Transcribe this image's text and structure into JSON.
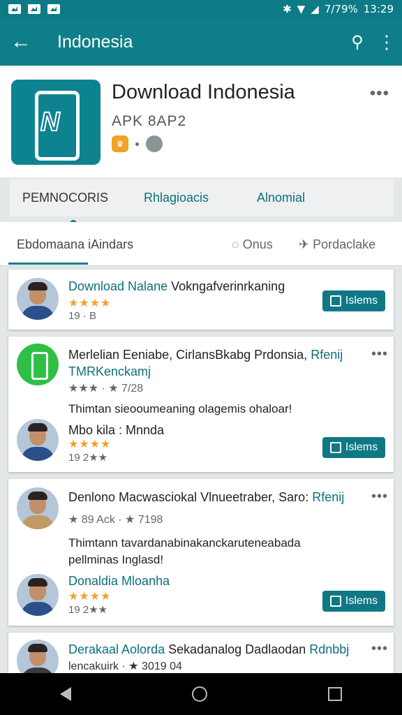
{
  "status_bar": {
    "battery": "7/79%",
    "time": "13:29"
  },
  "app_bar": {
    "back_icon": "arrow-left-icon",
    "title": "Indonesia",
    "search_icon": "search-icon",
    "more_icon": "more-vert-icon"
  },
  "app_header": {
    "title": "Download Indonesia",
    "subtitle": "APK 8AP2",
    "more": "•••"
  },
  "tabs": [
    "PEMNOCORIS",
    "Rhlagioacis",
    "Alnomial"
  ],
  "sub_tabs": {
    "left": "Ebdomaana iAindars",
    "onus": "Onus",
    "porda": "Pordaclake"
  },
  "cards": [
    {
      "line1_a": "Download Nalane",
      "line1_b": " Vokngafverinrkaning",
      "stars": "★★★★",
      "meta": "19 · B",
      "install": "Islems"
    },
    {
      "line1_a": "Merlelian Eeniabe, CirlansBkabg Prdonsia,",
      "line1_b": " Rfenij",
      "line2": "TMRKenckamj",
      "rating": "★★★ · ★ 7/28",
      "desc": "Thimtan sieooumeaning olagemis ohaloar!",
      "sub_name": "Mbo kila : Mnnda",
      "sub_stars": "★★★★",
      "sub_meta": "19  2★★",
      "install": "Islems"
    },
    {
      "line1_a": "Denlono Macwasciokal Vlnueetraber, Saro:",
      "line1_b": " Rfenij",
      "rating": "★ 89 Ack · ★ 7198",
      "desc": "Thimtann tavardanabinakanckaruteneabada",
      "desc2": "pellminas Inglasd!",
      "sub_name": "Donaldia Mloanha",
      "sub_stars": "★★★★",
      "sub_meta": "19  2★★",
      "install": "Islems"
    },
    {
      "line1_a": "Derakaal Aolorda",
      "line1_b": " Sekadanalog Dadlaodan",
      "line1_c": " Rdnbbj",
      "line2": "lencakuirk · ★ 3019 04"
    }
  ],
  "colors": {
    "teal": "#0e7f8a",
    "star": "#f2a227",
    "green": "#2fbf46"
  }
}
